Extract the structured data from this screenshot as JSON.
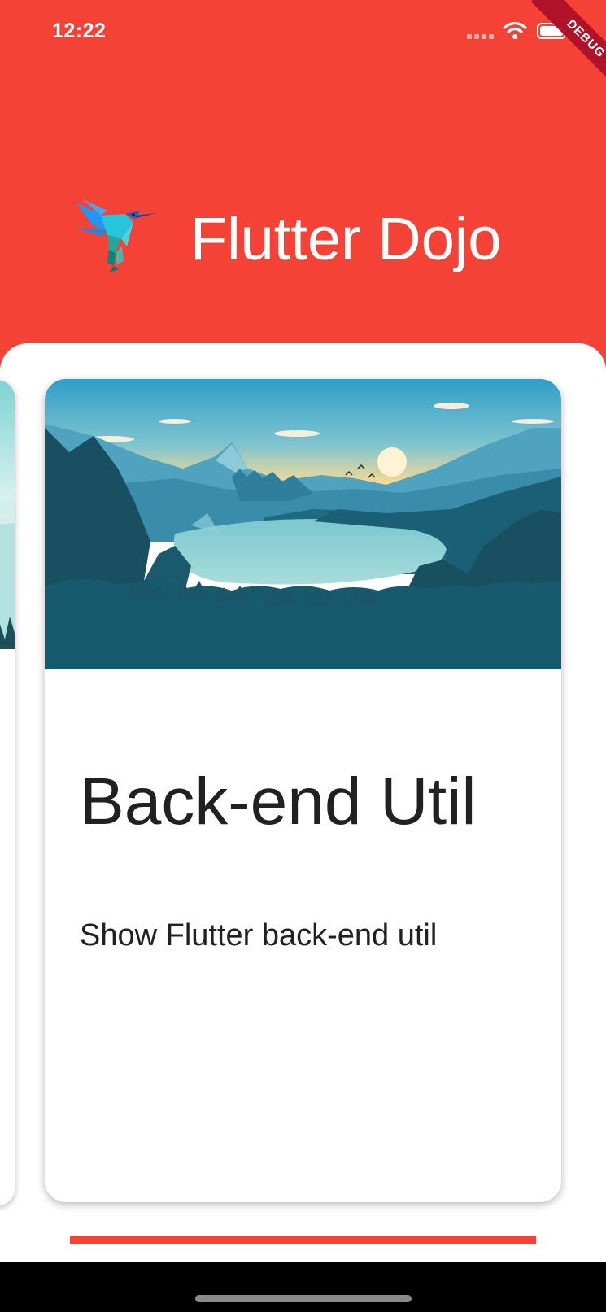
{
  "status_bar": {
    "time": "12:22",
    "icons": [
      "signal-icon",
      "wifi-icon",
      "battery-icon"
    ]
  },
  "debug_banner": "DEBUG",
  "header": {
    "title": "Flutter Dojo",
    "logo": "hummingbird-logo-icon",
    "background_color": "#F44336"
  },
  "carousel": {
    "active_card": {
      "title": "Back-end Util",
      "subtitle": "Show Flutter back-end util",
      "image": "mountain-lake-landscape"
    }
  },
  "colors": {
    "accent": "#F44336",
    "text": "#212121",
    "debug_banner": "#B0122A"
  }
}
